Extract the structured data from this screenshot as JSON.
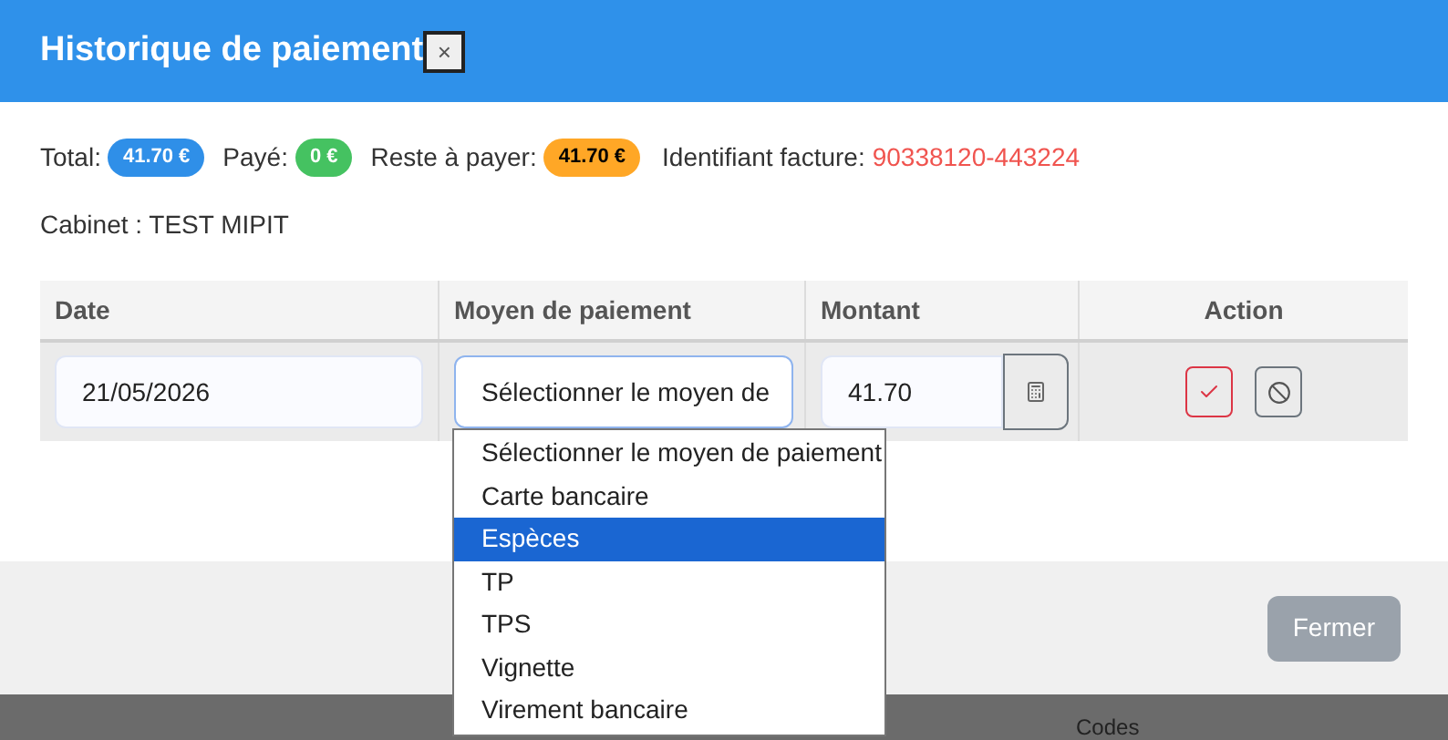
{
  "dialog": {
    "title": "Historique de paiement",
    "close_label": "×"
  },
  "summary": [
    {
      "label": "Total:",
      "value": "41.70 €",
      "color": "#2f8fe8"
    },
    {
      "label": "Payé:",
      "value": "0 €",
      "color": "#45c261"
    },
    {
      "label": "Reste à payer:",
      "value": "41.70 €",
      "color": "#ffa726"
    }
  ],
  "invoice": {
    "label": "Identifiant facture:",
    "value": "90338120-443224"
  },
  "cabinet": "Cabinet : TEST MIPIT",
  "table": {
    "columns": [
      "Date",
      "Moyen de paiement",
      "Montant",
      "Action"
    ],
    "row": {
      "date": "21/05/2026",
      "payment_method": "Sélectionner le moyen de",
      "amount": "41.70"
    }
  },
  "dropdown": {
    "options": [
      {
        "label": "Sélectionner le moyen de paiement",
        "selected": false
      },
      {
        "label": "Carte bancaire",
        "selected": false
      },
      {
        "label": "Espèces",
        "selected": true
      },
      {
        "label": "TP",
        "selected": false
      },
      {
        "label": "TPS",
        "selected": false
      },
      {
        "label": "Vignette",
        "selected": false
      },
      {
        "label": "Virement bancaire",
        "selected": false
      }
    ]
  },
  "footer": {
    "close_button": {
      "label": "Fermer",
      "disabled": true
    }
  },
  "background": {
    "column_heading": "Codes"
  }
}
